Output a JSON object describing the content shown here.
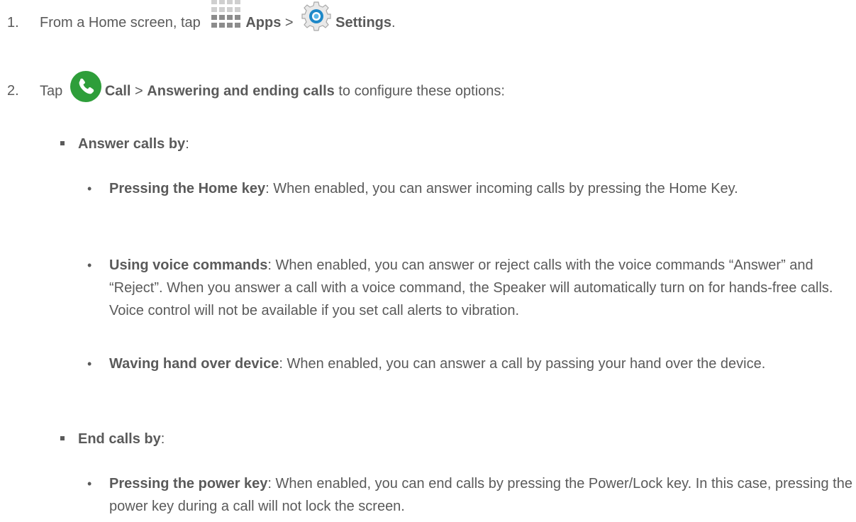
{
  "steps": [
    {
      "number": "1.",
      "text_before": "From a Home screen, tap ",
      "apps_label": "Apps",
      "separator": " > ",
      "settings_label": "Settings",
      "text_after": "."
    },
    {
      "number": "2.",
      "text_before": "Tap ",
      "call_label": "Call",
      "separator": " > ",
      "answering_label": "Answering and ending calls",
      "text_after": " to configure these options:"
    }
  ],
  "answer_section": {
    "heading": "Answer calls by",
    "colon": ":",
    "items": [
      {
        "term": "Pressing the Home key",
        "desc": ": When enabled, you can answer incoming calls by pressing the Home Key."
      },
      {
        "term": "Using voice commands",
        "desc": ": When enabled, you can answer or reject calls with the voice commands “Answer” and “Reject”. When you answer a call with a voice command, the Speaker will automatically turn on for hands-free calls. Voice control will not be available if you set call alerts to vibration."
      },
      {
        "term": "Waving hand over device",
        "desc": ": When enabled, you can answer a call by passing your hand over the device."
      }
    ]
  },
  "end_section": {
    "heading": "End calls by",
    "colon": ":",
    "items": [
      {
        "term": "Pressing the power key",
        "desc": ": When enabled, you can end calls by pressing the Power/Lock key. In this case, pressing the power key during a call will not lock the screen."
      }
    ]
  },
  "bullet_char": "•",
  "icons": {
    "apps": "apps-grid-icon",
    "settings": "settings-gear-icon",
    "call": "phone-icon"
  },
  "colors": {
    "text": "#5a5a5a",
    "phone_green": "#2e9e3a",
    "settings_blue": "#1e88c8"
  }
}
